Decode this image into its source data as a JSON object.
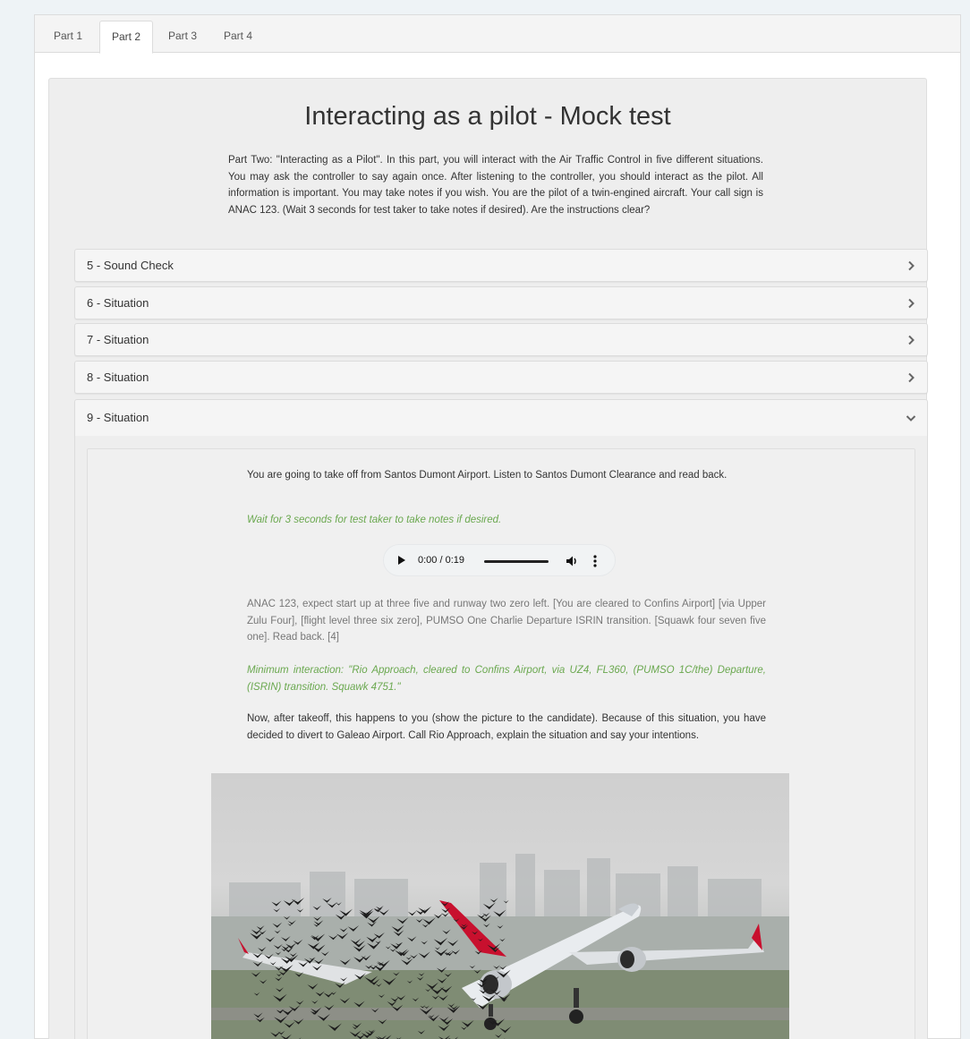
{
  "tabs": [
    "Part 1",
    "Part 2",
    "Part 3",
    "Part 4"
  ],
  "active_tab": "Part 2",
  "title": "Interacting as a pilot - Mock test",
  "intro": "Part Two: \"Interacting as a Pilot\". In this part, you will interact with the Air Traffic Control in five different situations. You may ask the controller to say again once. After listening to the controller, you should interact as the pilot. All information is important. You may take notes if you wish. You are the pilot of a twin-engined aircraft. Your call sign is ANAC 123. (Wait 3 seconds for test taker to take notes if desired). Are the instructions clear?",
  "accordion": [
    {
      "label": "5 - Sound Check",
      "expanded": false
    },
    {
      "label": "6 - Situation",
      "expanded": false
    },
    {
      "label": "7 - Situation",
      "expanded": false
    },
    {
      "label": "8 - Situation",
      "expanded": false
    },
    {
      "label": "9 - Situation",
      "expanded": true
    }
  ],
  "situation9": {
    "prompt": "You are going to take off from Santos Dumont Airport. Listen to Santos Dumont Clearance and read back.",
    "wait_note": "Wait for 3 seconds for test taker to take notes if desired.",
    "audio": {
      "time": "0:00 / 0:19"
    },
    "transcript": "ANAC 123, expect start up at three five and runway two zero left. [You are cleared to Confins Airport] [via Upper Zulu Four], [flight level three six zero], PUMSO One Charlie Departure ISRIN transition. [Squawk four seven five one]. Read back. [4]",
    "minimum": "Minimum interaction: \"Rio Approach, cleared to Confins Airport, via UZ4, FL360, (PUMSO 1C/the) Departure, (ISRIN) transition. Squawk 4751.\"",
    "followup": "Now, after takeoff, this happens to you (show the picture to the candidate). Because of this situation, you have decided to divert to Galeao Airport. Call Rio Approach, explain the situation and say your intentions.",
    "image_subject": "airliner-bird-strike-photo"
  },
  "colors": {
    "green_note": "#6aa84f",
    "gray_text": "#777777",
    "panel_bg": "#f5f5f5"
  }
}
